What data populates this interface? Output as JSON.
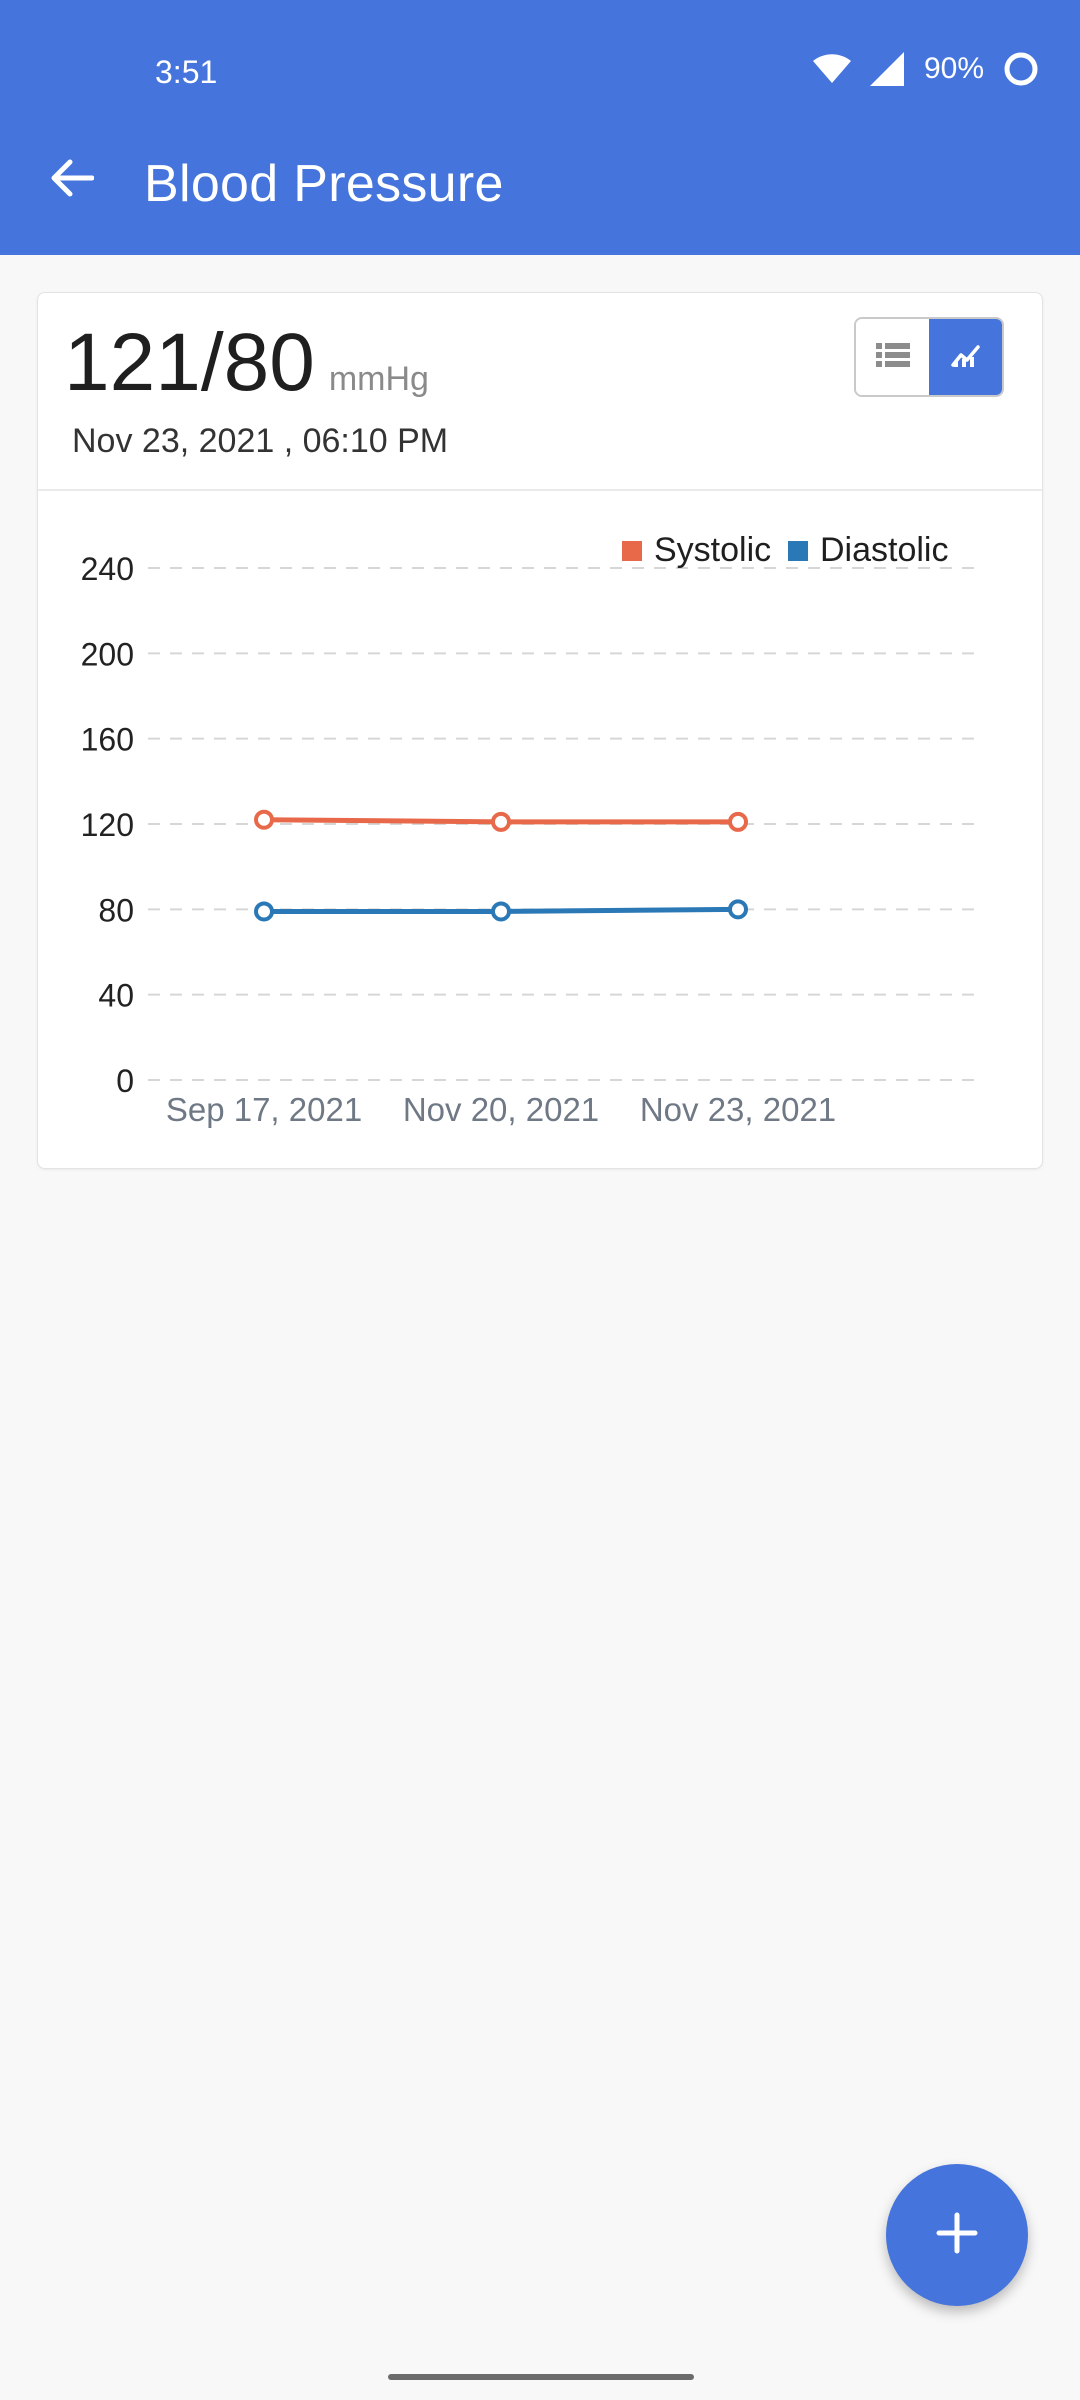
{
  "status_bar": {
    "time": "3:51",
    "battery": "90%"
  },
  "app_bar": {
    "title": "Blood Pressure",
    "back_icon": "arrow-left-icon"
  },
  "reading": {
    "value": "121/80",
    "unit": "mmHg",
    "datetime": "Nov 23, 2021 , 06:10 PM"
  },
  "view_toggle": {
    "options": [
      "list-icon",
      "chart-icon"
    ],
    "selected": "chart-icon"
  },
  "colors": {
    "primary": "#4474dc",
    "systolic": "#e8694a",
    "diastolic": "#2a78b5"
  },
  "chart_data": {
    "type": "line",
    "categories": [
      "Sep 17, 2021",
      "Nov 20, 2021",
      "Nov 23, 2021"
    ],
    "series": [
      {
        "name": "Systolic",
        "values": [
          122,
          121,
          121
        ]
      },
      {
        "name": "Diastolic",
        "values": [
          79,
          79,
          80
        ]
      }
    ],
    "y_ticks": [
      0,
      40,
      80,
      120,
      160,
      200,
      240
    ],
    "ylim": [
      0,
      240
    ],
    "grid": "dashed horizontal",
    "legend_position": "top-right"
  },
  "fab": {
    "icon": "plus-icon"
  }
}
